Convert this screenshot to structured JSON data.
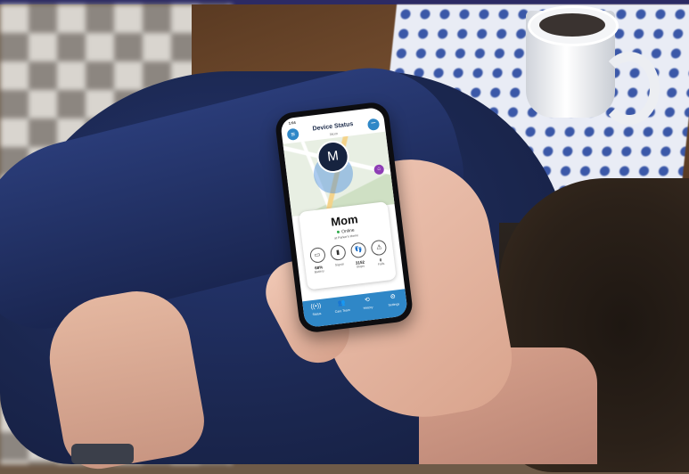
{
  "app": {
    "status_time": "1:04",
    "title": "Device Status",
    "subtitle": "Mom",
    "avatar_initial": "M"
  },
  "card": {
    "name": "Mom",
    "status": "Online",
    "place": "at Parker's Home"
  },
  "stats": [
    {
      "icon": "battery-icon",
      "glyph": "▭",
      "value": "68%",
      "label": "Battery"
    },
    {
      "icon": "signal-icon",
      "glyph": "▮",
      "value": "",
      "label": "Signal"
    },
    {
      "icon": "steps-icon",
      "glyph": "👣",
      "value": "3152",
      "label": "Steps"
    },
    {
      "icon": "falls-icon",
      "glyph": "⚠",
      "value": "0",
      "label": "Falls"
    }
  ],
  "tabs": [
    {
      "icon": "status-icon",
      "glyph": "((•))",
      "label": "Status"
    },
    {
      "icon": "care-team-icon",
      "glyph": "👥",
      "label": "Care Team"
    },
    {
      "icon": "history-icon",
      "glyph": "⟲",
      "label": "History"
    },
    {
      "icon": "settings-icon",
      "glyph": "⚙",
      "label": "Settings"
    }
  ],
  "colors": {
    "accent": "#2f87c7",
    "online": "#2eaa4a",
    "geofence": "#8e3db5"
  }
}
